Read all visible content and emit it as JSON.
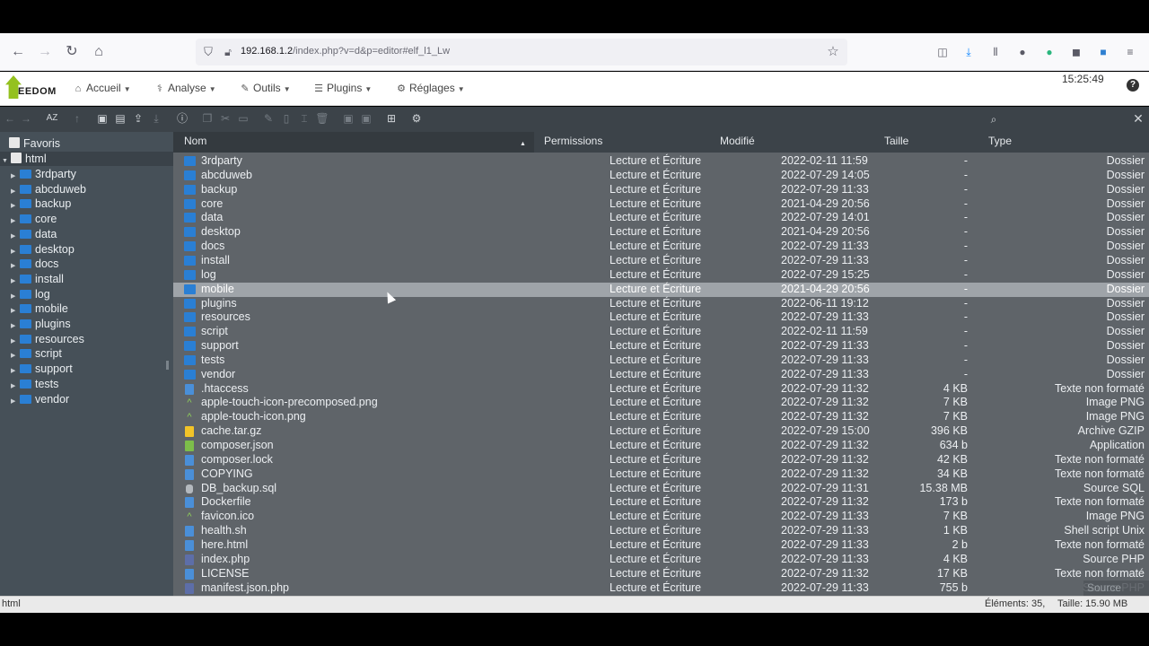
{
  "browser": {
    "url_host": "192.168.1.2",
    "url_path": "/index.php?v=d&p=editor#elf_l1_Lw"
  },
  "app": {
    "logo_text": "EEDOM",
    "menu": [
      {
        "label": "Accueil",
        "icon": "home-icon"
      },
      {
        "label": "Analyse",
        "icon": "stethoscope-icon"
      },
      {
        "label": "Outils",
        "icon": "wrench-icon"
      },
      {
        "label": "Plugins",
        "icon": "list-icon"
      },
      {
        "label": "Réglages",
        "icon": "gear-icon"
      }
    ],
    "clock": "15:25:49",
    "help": "?"
  },
  "tree": {
    "favorites": "Favoris",
    "root": "html",
    "children": [
      "3rdparty",
      "abcduweb",
      "backup",
      "core",
      "data",
      "desktop",
      "docs",
      "install",
      "log",
      "mobile",
      "plugins",
      "resources",
      "script",
      "support",
      "tests",
      "vendor"
    ]
  },
  "columns": {
    "name": "Nom",
    "permissions": "Permissions",
    "modified": "Modifié",
    "size": "Taille",
    "type": "Type"
  },
  "files": [
    {
      "name": "3rdparty",
      "perm": "Lecture et Écriture",
      "date": "2022-02-11 11:59",
      "size": "-",
      "type": "Dossier",
      "kind": "folder"
    },
    {
      "name": "abcduweb",
      "perm": "Lecture et Écriture",
      "date": "2022-07-29 14:05",
      "size": "-",
      "type": "Dossier",
      "kind": "folder"
    },
    {
      "name": "backup",
      "perm": "Lecture et Écriture",
      "date": "2022-07-29 11:33",
      "size": "-",
      "type": "Dossier",
      "kind": "folder"
    },
    {
      "name": "core",
      "perm": "Lecture et Écriture",
      "date": "2021-04-29 20:56",
      "size": "-",
      "type": "Dossier",
      "kind": "folder"
    },
    {
      "name": "data",
      "perm": "Lecture et Écriture",
      "date": "2022-07-29 14:01",
      "size": "-",
      "type": "Dossier",
      "kind": "folder"
    },
    {
      "name": "desktop",
      "perm": "Lecture et Écriture",
      "date": "2021-04-29 20:56",
      "size": "-",
      "type": "Dossier",
      "kind": "folder"
    },
    {
      "name": "docs",
      "perm": "Lecture et Écriture",
      "date": "2022-07-29 11:33",
      "size": "-",
      "type": "Dossier",
      "kind": "folder"
    },
    {
      "name": "install",
      "perm": "Lecture et Écriture",
      "date": "2022-07-29 11:33",
      "size": "-",
      "type": "Dossier",
      "kind": "folder"
    },
    {
      "name": "log",
      "perm": "Lecture et Écriture",
      "date": "2022-07-29 15:25",
      "size": "-",
      "type": "Dossier",
      "kind": "folder"
    },
    {
      "name": "mobile",
      "perm": "Lecture et Écriture",
      "date": "2021-04-29 20:56",
      "size": "-",
      "type": "Dossier",
      "kind": "folder",
      "selected": true
    },
    {
      "name": "plugins",
      "perm": "Lecture et Écriture",
      "date": "2022-06-11 19:12",
      "size": "-",
      "type": "Dossier",
      "kind": "folder"
    },
    {
      "name": "resources",
      "perm": "Lecture et Écriture",
      "date": "2022-07-29 11:33",
      "size": "-",
      "type": "Dossier",
      "kind": "folder"
    },
    {
      "name": "script",
      "perm": "Lecture et Écriture",
      "date": "2022-02-11 11:59",
      "size": "-",
      "type": "Dossier",
      "kind": "folder"
    },
    {
      "name": "support",
      "perm": "Lecture et Écriture",
      "date": "2022-07-29 11:33",
      "size": "-",
      "type": "Dossier",
      "kind": "folder"
    },
    {
      "name": "tests",
      "perm": "Lecture et Écriture",
      "date": "2022-07-29 11:33",
      "size": "-",
      "type": "Dossier",
      "kind": "folder"
    },
    {
      "name": "vendor",
      "perm": "Lecture et Écriture",
      "date": "2022-07-29 11:33",
      "size": "-",
      "type": "Dossier",
      "kind": "folder"
    },
    {
      "name": ".htaccess",
      "perm": "Lecture et Écriture",
      "date": "2022-07-29 11:32",
      "size": "4 KB",
      "type": "Texte non formaté",
      "kind": "text"
    },
    {
      "name": "apple-touch-icon-precomposed.png",
      "perm": "Lecture et Écriture",
      "date": "2022-07-29 11:32",
      "size": "7 KB",
      "type": "Image PNG",
      "kind": "image"
    },
    {
      "name": "apple-touch-icon.png",
      "perm": "Lecture et Écriture",
      "date": "2022-07-29 11:32",
      "size": "7 KB",
      "type": "Image PNG",
      "kind": "image"
    },
    {
      "name": "cache.tar.gz",
      "perm": "Lecture et Écriture",
      "date": "2022-07-29 15:00",
      "size": "396 KB",
      "type": "Archive GZIP",
      "kind": "archive"
    },
    {
      "name": "composer.json",
      "perm": "Lecture et Écriture",
      "date": "2022-07-29 11:32",
      "size": "634 b",
      "type": "Application",
      "kind": "json"
    },
    {
      "name": "composer.lock",
      "perm": "Lecture et Écriture",
      "date": "2022-07-29 11:32",
      "size": "42 KB",
      "type": "Texte non formaté",
      "kind": "text"
    },
    {
      "name": "COPYING",
      "perm": "Lecture et Écriture",
      "date": "2022-07-29 11:32",
      "size": "34 KB",
      "type": "Texte non formaté",
      "kind": "text"
    },
    {
      "name": "DB_backup.sql",
      "perm": "Lecture et Écriture",
      "date": "2022-07-29 11:31",
      "size": "15.38 MB",
      "type": "Source SQL",
      "kind": "sql"
    },
    {
      "name": "Dockerfile",
      "perm": "Lecture et Écriture",
      "date": "2022-07-29 11:32",
      "size": "173 b",
      "type": "Texte non formaté",
      "kind": "text"
    },
    {
      "name": "favicon.ico",
      "perm": "Lecture et Écriture",
      "date": "2022-07-29 11:33",
      "size": "7 KB",
      "type": "Image PNG",
      "kind": "image"
    },
    {
      "name": "health.sh",
      "perm": "Lecture et Écriture",
      "date": "2022-07-29 11:33",
      "size": "1 KB",
      "type": "Shell script Unix",
      "kind": "sh"
    },
    {
      "name": "here.html",
      "perm": "Lecture et Écriture",
      "date": "2022-07-29 11:33",
      "size": "2 b",
      "type": "Texte non formaté",
      "kind": "text"
    },
    {
      "name": "index.php",
      "perm": "Lecture et Écriture",
      "date": "2022-07-29 11:33",
      "size": "4 KB",
      "type": "Source PHP",
      "kind": "php"
    },
    {
      "name": "LICENSE",
      "perm": "Lecture et Écriture",
      "date": "2022-07-29 11:32",
      "size": "17 KB",
      "type": "Texte non formaté",
      "kind": "text"
    },
    {
      "name": "manifest.json.php",
      "perm": "Lecture et Écriture",
      "date": "2022-07-29 11:33",
      "size": "755 b",
      "type": "Source PHP",
      "kind": "php"
    }
  ],
  "tooltip": "Source PHP",
  "status": {
    "path": "html",
    "elements": "Éléments: 35,",
    "size": "Taille: 15.90 MB"
  }
}
